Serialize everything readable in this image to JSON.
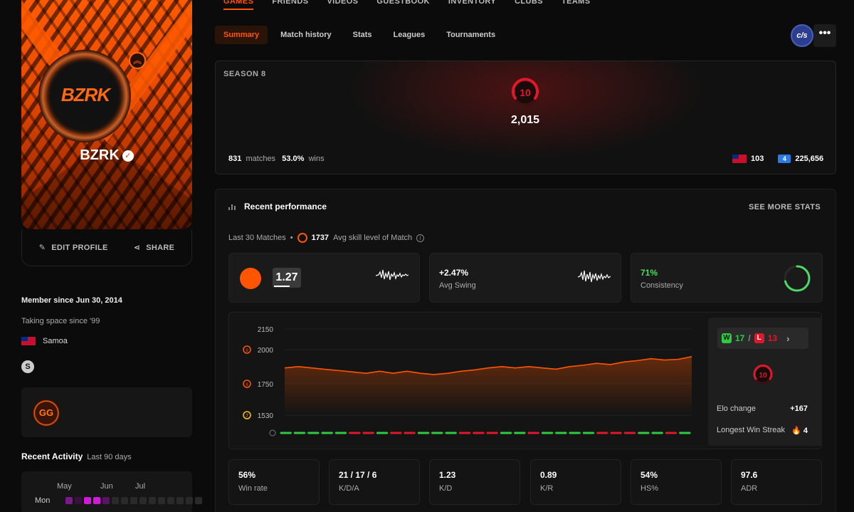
{
  "top_nav": {
    "items": [
      "GAMES",
      "FRIENDS",
      "VIDEOS",
      "GUESTBOOK",
      "INVENTORY",
      "CLUBS",
      "TEAMS"
    ]
  },
  "sub_tabs": {
    "items": [
      "Summary",
      "Match history",
      "Stats",
      "Leagues",
      "Tournaments"
    ]
  },
  "game_logo_text": "c/s",
  "more_label": "•••",
  "profile": {
    "avatar_text": "BZRK",
    "name": "BZRK",
    "edit_label": "EDIT PROFILE",
    "share_label": "SHARE",
    "member_since": "Member since Jun 30, 2014",
    "tagline": "Taking space since '99",
    "country": "Samoa",
    "gg_badge": "GG"
  },
  "recent_activity": {
    "title": "Recent Activity",
    "range": "Last 90 days",
    "months": [
      "May",
      "Jun",
      "Jul"
    ],
    "day_label": "Mon"
  },
  "season": {
    "label": "SEASON 8",
    "level": "10",
    "elo": "2,015",
    "matches": "831",
    "matches_label": "matches",
    "winrate": "53.0%",
    "wins_label": "wins",
    "country_rank": "103",
    "region_rank": "225,656"
  },
  "performance": {
    "title": "Recent performance",
    "see_more": "SEE MORE STATS",
    "last_label": "Last 30 Matches",
    "avg_skill": "1737",
    "avg_skill_label": "Avg skill level of Match",
    "rating": "1.27",
    "swing_value": "+2.47%",
    "swing_label": "Avg Swing",
    "consistency_value": "71%",
    "consistency_label": "Consistency",
    "consistency_fraction": 0.71
  },
  "chart_data": {
    "type": "area",
    "y_ticks": [
      "2150",
      "2000",
      "1750",
      "1530"
    ],
    "level_marks": [
      "9",
      "8",
      "7"
    ],
    "values": [
      1866,
      1876,
      1866,
      1856,
      1847,
      1837,
      1827,
      1842,
      1827,
      1842,
      1827,
      1818,
      1827,
      1842,
      1852,
      1866,
      1876,
      1866,
      1876,
      1866,
      1857,
      1876,
      1886,
      1900,
      1891,
      1910,
      1920,
      1934,
      1924,
      1929,
      1949
    ],
    "results": [
      "W",
      "W",
      "W",
      "W",
      "W",
      "L",
      "L",
      "W",
      "L",
      "L",
      "W",
      "W",
      "W",
      "L",
      "L",
      "L",
      "W",
      "W",
      "L",
      "W",
      "W",
      "W",
      "W",
      "L",
      "L",
      "L",
      "W",
      "W",
      "L",
      "W"
    ],
    "colors": {
      "line": "#ff5500",
      "win": "#2ecc40",
      "loss": "#e0182b"
    }
  },
  "chart_side": {
    "wins": "17",
    "losses": "13",
    "w_letter": "W",
    "l_letter": "L",
    "level": "10",
    "elo_change_label": "Elo change",
    "elo_change": "+167",
    "streak_label": "Longest Win Streak",
    "streak": "4"
  },
  "bottom_stats": [
    {
      "value": "56%",
      "label": "Win rate"
    },
    {
      "value": "21 / 17 / 6",
      "label": "K/D/A"
    },
    {
      "value": "1.23",
      "label": "K/D"
    },
    {
      "value": "0.89",
      "label": "K/R"
    },
    {
      "value": "54%",
      "label": "HS%"
    },
    {
      "value": "97.6",
      "label": "ADR"
    }
  ],
  "colors": {
    "accent": "#ff5500",
    "win": "#2ecc40",
    "loss": "#e0182b",
    "level": "#e0182b"
  }
}
